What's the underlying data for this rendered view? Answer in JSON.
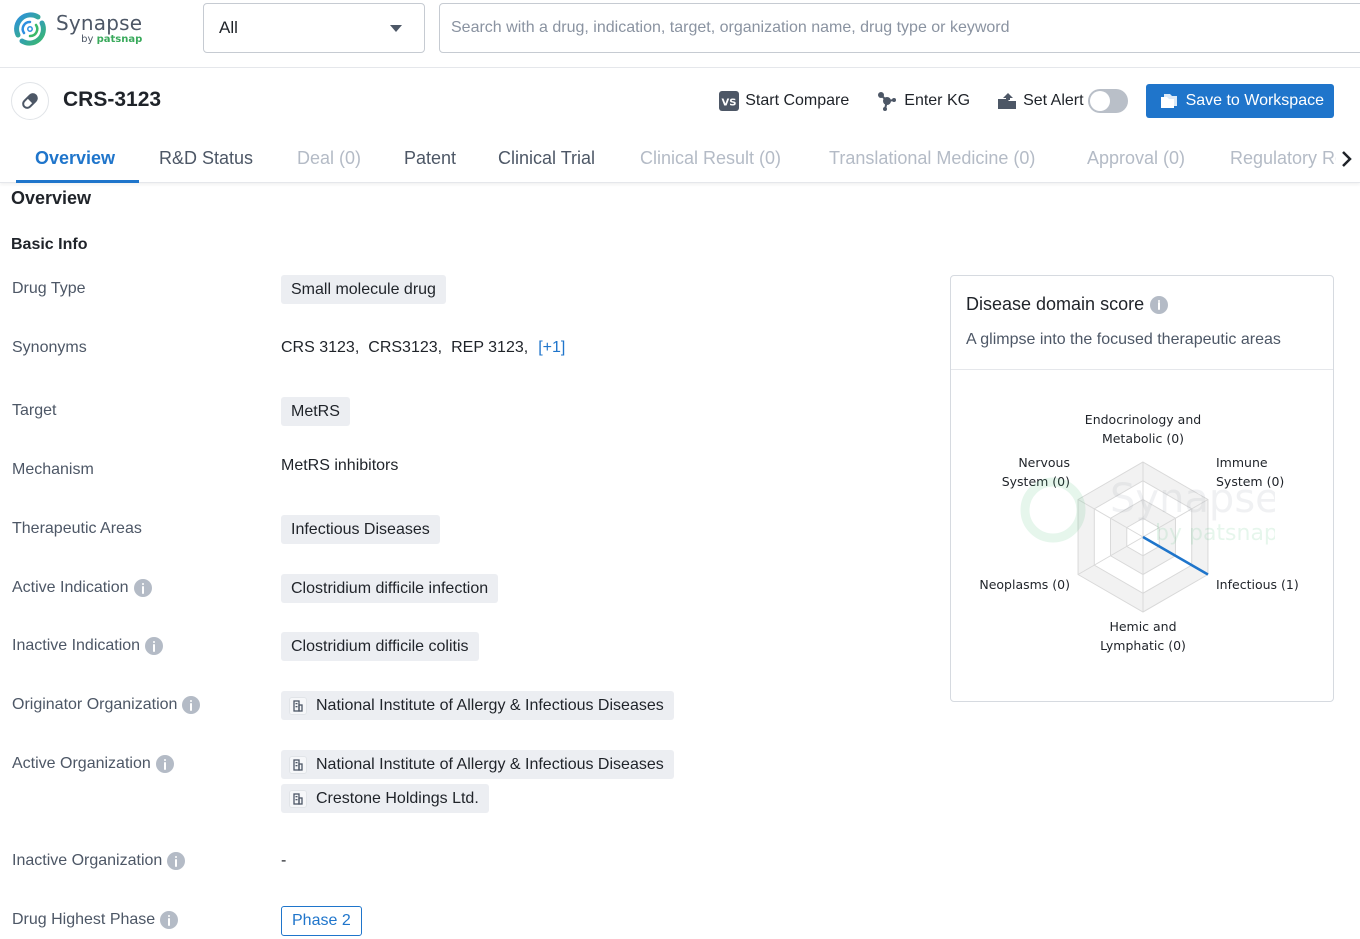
{
  "app": {
    "name": "Synapse",
    "by": "by",
    "brand": "patsnap"
  },
  "search": {
    "scope_value": "All",
    "placeholder": "Search with a drug, indication, target, organization name, drug type or keyword",
    "value": ""
  },
  "drug": {
    "title": "CRS-3123",
    "icon": "pill-icon"
  },
  "actions": {
    "compare": "Start Compare",
    "kg": "Enter KG",
    "alert": "Set Alert",
    "alert_enabled": false,
    "save": "Save to Workspace"
  },
  "tabs": [
    {
      "label": "Overview",
      "state": "active"
    },
    {
      "label": "R&D Status",
      "state": "normal"
    },
    {
      "label": "Deal (0)",
      "state": "disabled"
    },
    {
      "label": "Patent",
      "state": "normal"
    },
    {
      "label": "Clinical Trial",
      "state": "normal"
    },
    {
      "label": "Clinical Result (0)",
      "state": "disabled"
    },
    {
      "label": "Translational Medicine (0)",
      "state": "disabled"
    },
    {
      "label": "Approval (0)",
      "state": "disabled"
    },
    {
      "label": "Regulatory Review",
      "state": "disabled"
    }
  ],
  "overview": {
    "section_title": "Overview",
    "basic_info_title": "Basic Info",
    "drug_type": {
      "label": "Drug Type",
      "value": "Small molecule drug"
    },
    "synonyms": {
      "label": "Synonyms",
      "values": [
        "CRS 3123,",
        "CRS3123,",
        "REP 3123,"
      ],
      "more": "[+1]"
    },
    "target": {
      "label": "Target",
      "value": "MetRS"
    },
    "mechanism": {
      "label": "Mechanism",
      "value": "MetRS inhibitors"
    },
    "therapeutic_areas": {
      "label": "Therapeutic Areas",
      "value": "Infectious Diseases"
    },
    "active_indication": {
      "label": "Active Indication",
      "value": "Clostridium difficile infection"
    },
    "inactive_indication": {
      "label": "Inactive Indication",
      "value": "Clostridium difficile colitis"
    },
    "originator_org": {
      "label": "Originator Organization",
      "values": [
        "National Institute of Allergy & Infectious Diseases"
      ]
    },
    "active_org": {
      "label": "Active Organization",
      "values": [
        "National Institute of Allergy & Infectious Diseases",
        "Crestone Holdings Ltd."
      ]
    },
    "inactive_org": {
      "label": "Inactive Organization",
      "value": "-"
    },
    "highest_phase": {
      "label": "Drug Highest Phase",
      "value": "Phase 2"
    }
  },
  "disease_domain": {
    "title": "Disease domain score",
    "subtitle": "A glimpse into the focused therapeutic areas",
    "accent_color": "#1f75cb"
  },
  "chart_data": {
    "type": "radar",
    "title": "Disease domain score",
    "axes": [
      {
        "name": "Endocrinology and Metabolic",
        "label_lines": [
          "Endocrinology and",
          "Metabolic (0)"
        ],
        "value": 0
      },
      {
        "name": "Immune System",
        "label_lines": [
          "Immune",
          "System (0)"
        ],
        "value": 0
      },
      {
        "name": "Infectious",
        "label_lines": [
          "Infectious (1)"
        ],
        "value": 1
      },
      {
        "name": "Hemic and Lymphatic",
        "label_lines": [
          "Hemic and",
          "Lymphatic (0)"
        ],
        "value": 0
      },
      {
        "name": "Neoplasms",
        "label_lines": [
          "Neoplasms (0)"
        ],
        "value": 0
      },
      {
        "name": "Nervous System",
        "label_lines": [
          "Nervous",
          "System (0)"
        ],
        "value": 0
      }
    ],
    "range": [
      0,
      1
    ],
    "rings": 4,
    "series_color": "#1f75cb"
  }
}
